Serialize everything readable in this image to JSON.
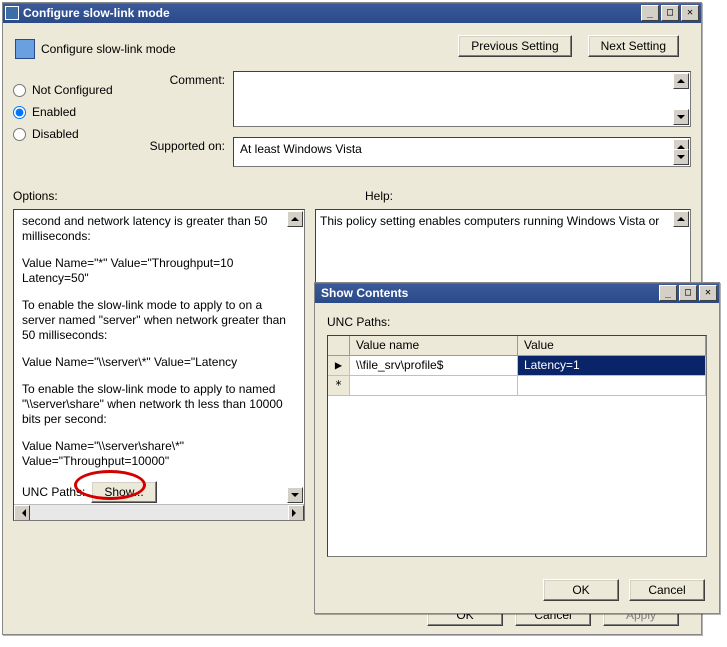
{
  "main": {
    "title": "Configure slow-link mode",
    "heading": "Configure slow-link mode",
    "prev_btn": "Previous Setting",
    "next_btn": "Next Setting",
    "radios": {
      "not_configured": "Not Configured",
      "enabled": "Enabled",
      "disabled": "Disabled"
    },
    "comment_label": "Comment:",
    "supported_label": "Supported on:",
    "supported_value": "At least Windows Vista",
    "options_label": "Options:",
    "help_label": "Help:",
    "help_text": "This policy setting enables computers running Windows Vista or",
    "options_lines": {
      "l1": "second and network latency is greater than 50 milliseconds:",
      "l2": " Value Name=\"*\" Value=\"Throughput=10 Latency=50\"",
      "l3": "To enable the slow-link mode to apply to on a server named \"server\" when network greater than 50 milliseconds:",
      "l4": " Value Name=\"\\\\server\\*\" Value=\"Latency",
      "l5": "To enable the slow-link mode to apply to named \"\\\\server\\share\" when network th less than 10000 bits per second:",
      "l6": " Value Name=\"\\\\server\\share\\*\" Value=\"Throughput=10000\""
    },
    "unc_label": "UNC Paths:",
    "show_btn": "Show...",
    "ok_btn": "OK",
    "cancel_btn": "Cancel",
    "apply_btn": "Apply"
  },
  "showdlg": {
    "title": "Show Contents",
    "unc_label": "UNC Paths:",
    "col_valuename": "Value name",
    "col_value": "Value",
    "rows": [
      {
        "name": "\\\\file_srv\\profile$",
        "value": "Latency=1"
      }
    ],
    "row_marker": "▶",
    "new_marker": "*",
    "ok_btn": "OK",
    "cancel_btn": "Cancel"
  }
}
